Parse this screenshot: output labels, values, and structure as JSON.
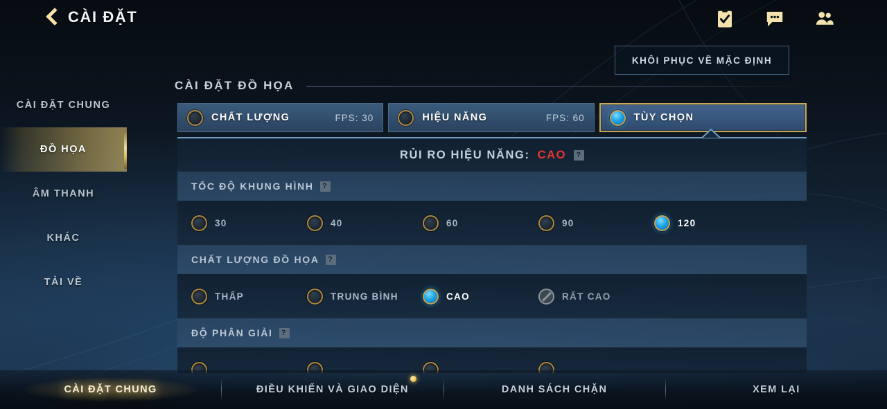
{
  "header": {
    "title": "CÀI ĐẶT",
    "back_icon": "chevron-left-icon",
    "icons": [
      {
        "name": "mission-clipboard-icon"
      },
      {
        "name": "chat-icon"
      },
      {
        "name": "friends-icon"
      }
    ]
  },
  "restore_button": {
    "label": "KHÔI PHỤC VỀ MẶC ĐỊNH"
  },
  "sidebar": {
    "items": [
      {
        "label": "CÀI ĐẶT CHUNG",
        "name": "sidebar-item-general",
        "active": false
      },
      {
        "label": "ĐỒ HỌA",
        "name": "sidebar-item-graphics",
        "active": true
      },
      {
        "label": "ÂM THANH",
        "name": "sidebar-item-audio",
        "active": false
      },
      {
        "label": "KHÁC",
        "name": "sidebar-item-other",
        "active": false
      },
      {
        "label": "TẢI VỀ",
        "name": "sidebar-item-download",
        "active": false
      }
    ]
  },
  "section": {
    "title": "CÀI ĐẶT ĐỒ HỌA"
  },
  "presets": [
    {
      "label": "CHẤT LƯỢNG",
      "fps": "FPS: 30",
      "selected": false
    },
    {
      "label": "HIỆU NĂNG",
      "fps": "FPS: 60",
      "selected": false
    },
    {
      "label": "TÙY CHỌN",
      "fps": "",
      "selected": true
    }
  ],
  "risk": {
    "label": "RỦI RO HIỆU NĂNG:",
    "value": "CAO",
    "value_color": "#e8352d",
    "help": "?"
  },
  "groups": [
    {
      "name": "frame-rate",
      "title": "TỐC ĐỘ KHUNG HÌNH",
      "help": "?",
      "options": [
        {
          "label": "30",
          "state": "off"
        },
        {
          "label": "40",
          "state": "off"
        },
        {
          "label": "60",
          "state": "off"
        },
        {
          "label": "90",
          "state": "off"
        },
        {
          "label": "120",
          "state": "on"
        }
      ]
    },
    {
      "name": "graphics-quality",
      "title": "CHẤT LƯỢNG ĐỒ HỌA",
      "help": "?",
      "options": [
        {
          "label": "THẤP",
          "state": "off"
        },
        {
          "label": "TRUNG BÌNH",
          "state": "off"
        },
        {
          "label": "CAO",
          "state": "on"
        },
        {
          "label": "RẤT CAO",
          "state": "disabled"
        }
      ]
    },
    {
      "name": "resolution",
      "title": "ĐỘ PHÂN GIẢI",
      "help": "?",
      "options": []
    }
  ],
  "bottom_tabs": [
    {
      "label": "CÀI ĐẶT CHUNG",
      "name": "bottom-tab-general",
      "active": true,
      "dot": false
    },
    {
      "label": "ĐIỀU KHIỂN VÀ GIAO DIỆN",
      "name": "bottom-tab-controls",
      "active": false,
      "dot": true
    },
    {
      "label": "DANH SÁCH CHẶN",
      "name": "bottom-tab-blocklist",
      "active": false,
      "dot": false
    },
    {
      "label": "XEM LẠI",
      "name": "bottom-tab-replay",
      "active": false,
      "dot": false
    }
  ],
  "colors": {
    "gold": "#d6b25c",
    "accent_blue": "#2fa8e6",
    "danger": "#e8352d"
  }
}
